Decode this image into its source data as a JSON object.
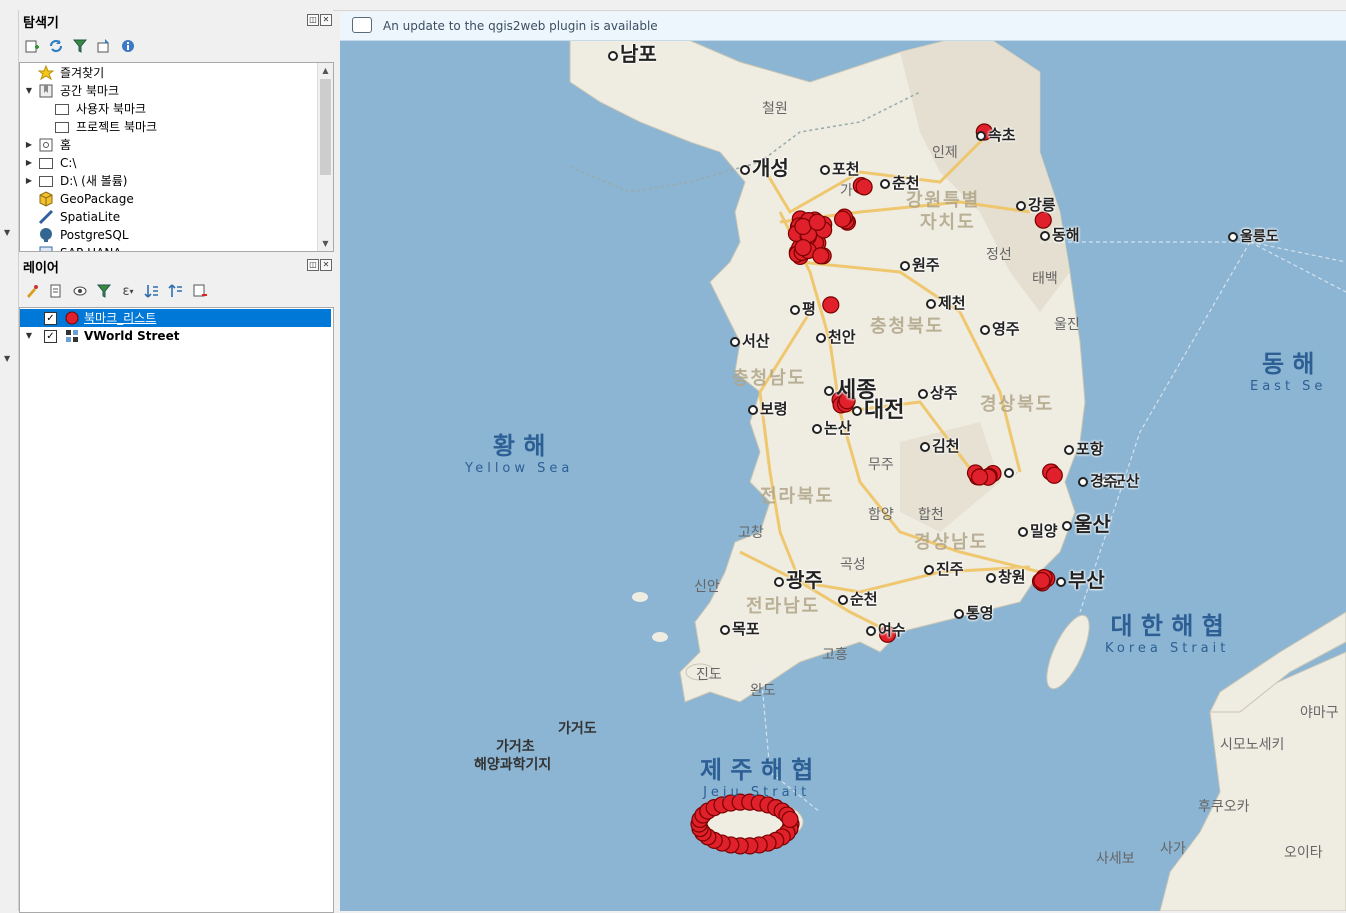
{
  "browser_panel": {
    "title": "탐색기",
    "toolbar": [
      "add-icon",
      "refresh-icon",
      "filter-icon",
      "collapse-icon",
      "info-icon"
    ],
    "items": [
      {
        "label": "즐겨찾기",
        "icon": "star-icon",
        "indent": 0,
        "expander": ""
      },
      {
        "label": "공간 북마크",
        "icon": "bookmark-icon",
        "indent": 0,
        "expander": "▼"
      },
      {
        "label": "사용자 북마크",
        "icon": "folder-icon",
        "indent": 1,
        "expander": ""
      },
      {
        "label": "프로젝트 북마크",
        "icon": "folder-icon",
        "indent": 1,
        "expander": ""
      },
      {
        "label": "홈",
        "icon": "home-icon",
        "indent": 0,
        "expander": "▶"
      },
      {
        "label": "C:\\",
        "icon": "folder-icon",
        "indent": 0,
        "expander": "▶"
      },
      {
        "label": "D:\\ (새 볼륨)",
        "icon": "folder-icon",
        "indent": 0,
        "expander": "▶"
      },
      {
        "label": "GeoPackage",
        "icon": "geopackage-icon",
        "indent": 0,
        "expander": ""
      },
      {
        "label": "SpatiaLite",
        "icon": "spatialite-icon",
        "indent": 0,
        "expander": ""
      },
      {
        "label": "PostgreSQL",
        "icon": "postgresql-icon",
        "indent": 0,
        "expander": ""
      },
      {
        "label": "SAP HANA",
        "icon": "sap-hana-icon",
        "indent": 0,
        "expander": ""
      }
    ]
  },
  "layers_panel": {
    "title": "레이어",
    "toolbar": [
      "style-icon",
      "add-group-icon",
      "visibility-icon",
      "filter-layer-icon",
      "expression-icon",
      "expand-all-icon",
      "collapse-all-icon",
      "remove-layer-icon"
    ],
    "layers": [
      {
        "label": "북마크_리스트",
        "checked": true,
        "selected": true,
        "icon": "red-point-icon",
        "expander": ""
      },
      {
        "label": "VWorld Street",
        "checked": true,
        "selected": false,
        "icon": "raster-icon",
        "expander": "▼"
      }
    ]
  },
  "message_bar": {
    "text": "An update to the qgis2web plugin is available"
  },
  "map": {
    "sea_color": "#8bb5d3",
    "land_color": "#efece2",
    "point_color": "#e0202a",
    "seas": [
      {
        "ko": "황 해",
        "en": "Yellow Sea"
      },
      {
        "ko": "동 해",
        "en": "East Se"
      },
      {
        "ko": "대 한 해 협",
        "en": "Korea Strait"
      },
      {
        "ko": "제 주 해 협",
        "en": "Jeju Strait"
      }
    ],
    "cities": [
      "남포",
      "개성",
      "포천",
      "춘천",
      "속초",
      "강릉",
      "동해",
      "울릉도",
      "원주",
      "제천",
      "영주",
      "평",
      "천안",
      "서산",
      "세종",
      "대전",
      "상주",
      "보령",
      "논산",
      "김천",
      "포항",
      "군산",
      "구",
      "경주",
      "울산",
      "밀양",
      "광주",
      "진주",
      "창원",
      "부산",
      "순천",
      "통영",
      "목포",
      "여수"
    ],
    "regions": [
      "강원특별",
      "자치도",
      "충청북도",
      "충청남도",
      "경상북도",
      "전라북도",
      "경상남도",
      "전라남도"
    ],
    "places_gray": [
      "철원",
      "인제",
      "정선",
      "태백",
      "울진",
      "무주",
      "함양",
      "합천",
      "고창",
      "곡성",
      "신안",
      "고흥",
      "진도",
      "완도",
      "야마구",
      "시모노세키",
      "후쿠오카",
      "사가",
      "사세보",
      "오이타",
      "가"
    ],
    "islands": [
      "가거도",
      "가거초",
      "해양과학기지"
    ],
    "point_count": 120
  }
}
